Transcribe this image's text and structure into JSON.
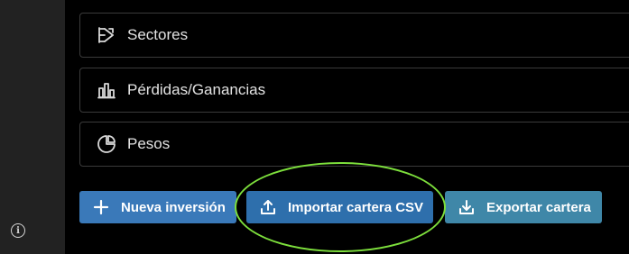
{
  "sections": [
    {
      "label": "Sectores",
      "icon": "sectors-icon"
    },
    {
      "label": "Pérdidas/Ganancias",
      "icon": "bar-chart-icon"
    },
    {
      "label": "Pesos",
      "icon": "pie-chart-icon"
    }
  ],
  "actions": {
    "new_investment": "Nueva inversión",
    "import_csv": "Importar cartera CSV",
    "export": "Exportar cartera"
  },
  "sidebar": {
    "info_icon": "info-icon"
  },
  "colors": {
    "background": "#000000",
    "sidebar": "#222222",
    "primary_button": "#3a79b9",
    "import_button": "#2e6fac",
    "export_button": "#3f87a8",
    "highlight": "#7ddf3c"
  }
}
